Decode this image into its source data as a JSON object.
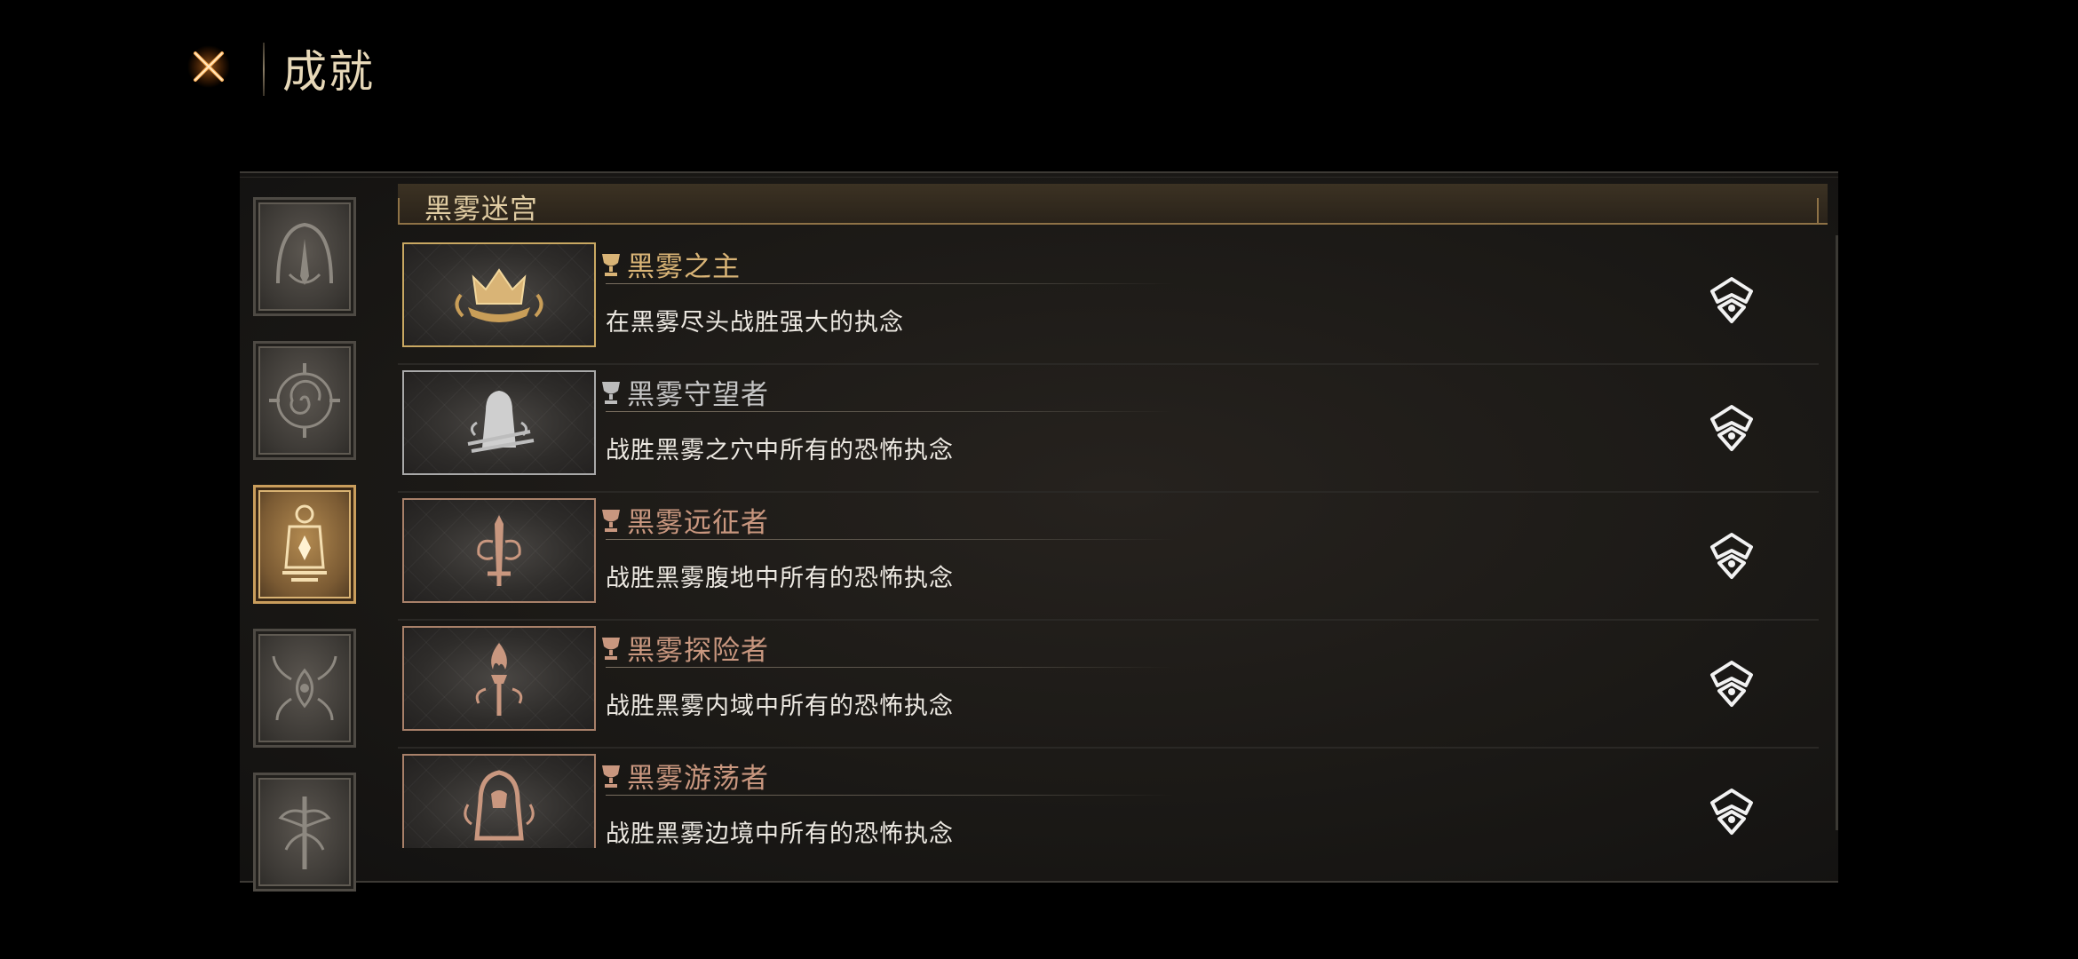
{
  "header": {
    "title": "成就",
    "close_icon": "close-x-icon"
  },
  "colors": {
    "accent_gold": "#d9b476",
    "silver": "#bcbcbc",
    "bronze": "#c9977f",
    "close_orange": "#ff8a2a"
  },
  "sidebar": {
    "tabs": [
      {
        "icon": "arch-spike-icon",
        "active": false
      },
      {
        "icon": "spiral-compass-icon",
        "active": false
      },
      {
        "icon": "lantern-icon",
        "active": true
      },
      {
        "icon": "winged-eye-icon",
        "active": false
      },
      {
        "icon": "tree-sword-icon",
        "active": false
      }
    ]
  },
  "section": {
    "title": "黑雾迷宫"
  },
  "achievements": [
    {
      "name": "黑雾之主",
      "description": "在黑雾尽头战胜强大的执念",
      "tier": "gold",
      "badge_icon": "crown-icon"
    },
    {
      "name": "黑雾守望者",
      "description": "战胜黑雾之穴中所有的恐怖执念",
      "tier": "silver",
      "badge_icon": "hooded-figure-icon"
    },
    {
      "name": "黑雾远征者",
      "description": "战胜黑雾腹地中所有的恐怖执念",
      "tier": "bronze",
      "badge_icon": "sword-emblem-icon"
    },
    {
      "name": "黑雾探险者",
      "description": "战胜黑雾内域中所有的恐怖执念",
      "tier": "bronze",
      "badge_icon": "flame-torch-icon"
    },
    {
      "name": "黑雾游荡者",
      "description": "战胜黑雾边境中所有的恐怖执念",
      "tier": "bronze",
      "badge_icon": "hooded-wanderer-icon"
    }
  ],
  "row_icons": {
    "tier_icon": "trophy-cup-icon",
    "reward_icon": "reward-emblem-icon"
  }
}
